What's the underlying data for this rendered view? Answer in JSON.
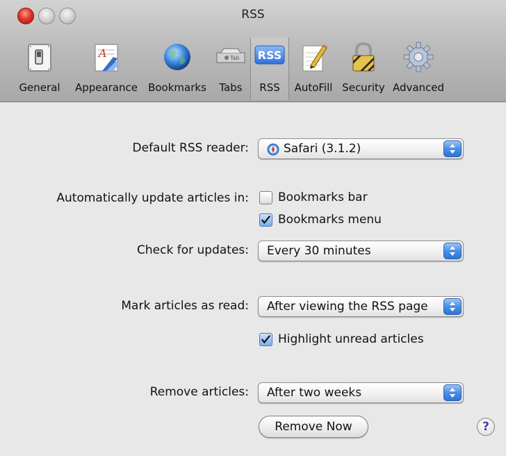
{
  "window": {
    "title": "RSS"
  },
  "toolbar": {
    "items": [
      {
        "label": "General",
        "icon": "switch-icon"
      },
      {
        "label": "Appearance",
        "icon": "font-icon"
      },
      {
        "label": "Bookmarks",
        "icon": "globe-icon"
      },
      {
        "label": "Tabs",
        "icon": "tab-icon",
        "badge": "Tab"
      },
      {
        "label": "RSS",
        "icon": "rss-icon",
        "badge": "RSS",
        "selected": true
      },
      {
        "label": "AutoFill",
        "icon": "pencil-icon"
      },
      {
        "label": "Security",
        "icon": "lock-icon"
      },
      {
        "label": "Advanced",
        "icon": "gear-icon"
      }
    ]
  },
  "form": {
    "default_reader": {
      "label": "Default RSS reader:",
      "value": "Safari (3.1.2)",
      "icon": "safari-compass-icon"
    },
    "auto_update": {
      "label": "Automatically update articles in:",
      "bookmarks_bar": {
        "label": "Bookmarks bar",
        "checked": false
      },
      "bookmarks_menu": {
        "label": "Bookmarks menu",
        "checked": true
      }
    },
    "check_updates": {
      "label": "Check for updates:",
      "value": "Every 30 minutes"
    },
    "mark_read": {
      "label": "Mark articles as read:",
      "value": "After viewing the RSS page"
    },
    "highlight_unread": {
      "label": "Highlight unread articles",
      "checked": true
    },
    "remove_articles": {
      "label": "Remove articles:",
      "value": "After two weeks"
    },
    "remove_now_button": "Remove Now",
    "help_button": "?"
  },
  "colors": {
    "accent": "#3b82e8",
    "titlebar": "#bdbdbd",
    "close": "#e0362a"
  }
}
